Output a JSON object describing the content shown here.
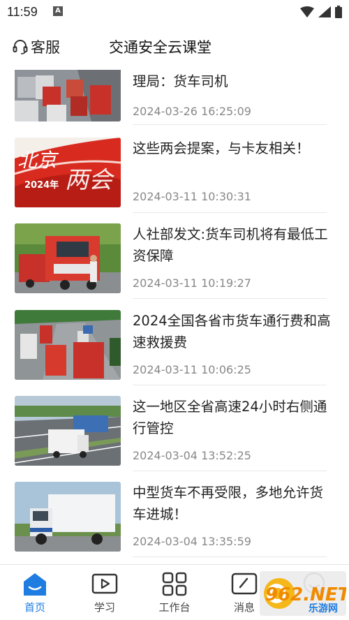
{
  "status_bar": {
    "time": "11:59",
    "notification_letter": "A"
  },
  "header": {
    "service_label": "客服",
    "title": "交通安全云课堂"
  },
  "news": [
    {
      "title": "理局：货车司机",
      "date": "2024-03-26 16:25:09"
    },
    {
      "title": "这些两会提案，与卡友相关！",
      "date": "2024-03-11 10:30:31",
      "thumb_text_1": "北京",
      "thumb_text_2": "两会",
      "thumb_year": "2024年"
    },
    {
      "title": "人社部发文:货车司机将有最低工资保障",
      "date": "2024-03-11 10:19:27"
    },
    {
      "title": "2024全国各省市货车通行费和高速救援费",
      "date": "2024-03-11 10:06:25"
    },
    {
      "title": "这一地区全省高速24小时右侧通行管控",
      "date": "2024-03-04 13:52:25"
    },
    {
      "title": "中型货车不再受限，多地允许货车进城！",
      "date": "2024-03-04 13:35:59"
    }
  ],
  "tabs": [
    {
      "label": "首页",
      "icon": "home-icon",
      "active": true
    },
    {
      "label": "学习",
      "icon": "play-icon",
      "active": false
    },
    {
      "label": "工作台",
      "icon": "grid-icon",
      "active": false
    },
    {
      "label": "消息",
      "icon": "message-icon",
      "active": false
    },
    {
      "label": "",
      "icon": "profile-icon",
      "active": false
    }
  ],
  "watermark": {
    "brand": "962.NET",
    "site": "乐游网"
  },
  "colors": {
    "accent": "#1f7ce0",
    "text": "#222222",
    "date": "#888888",
    "truck_red": "#c8312a"
  }
}
